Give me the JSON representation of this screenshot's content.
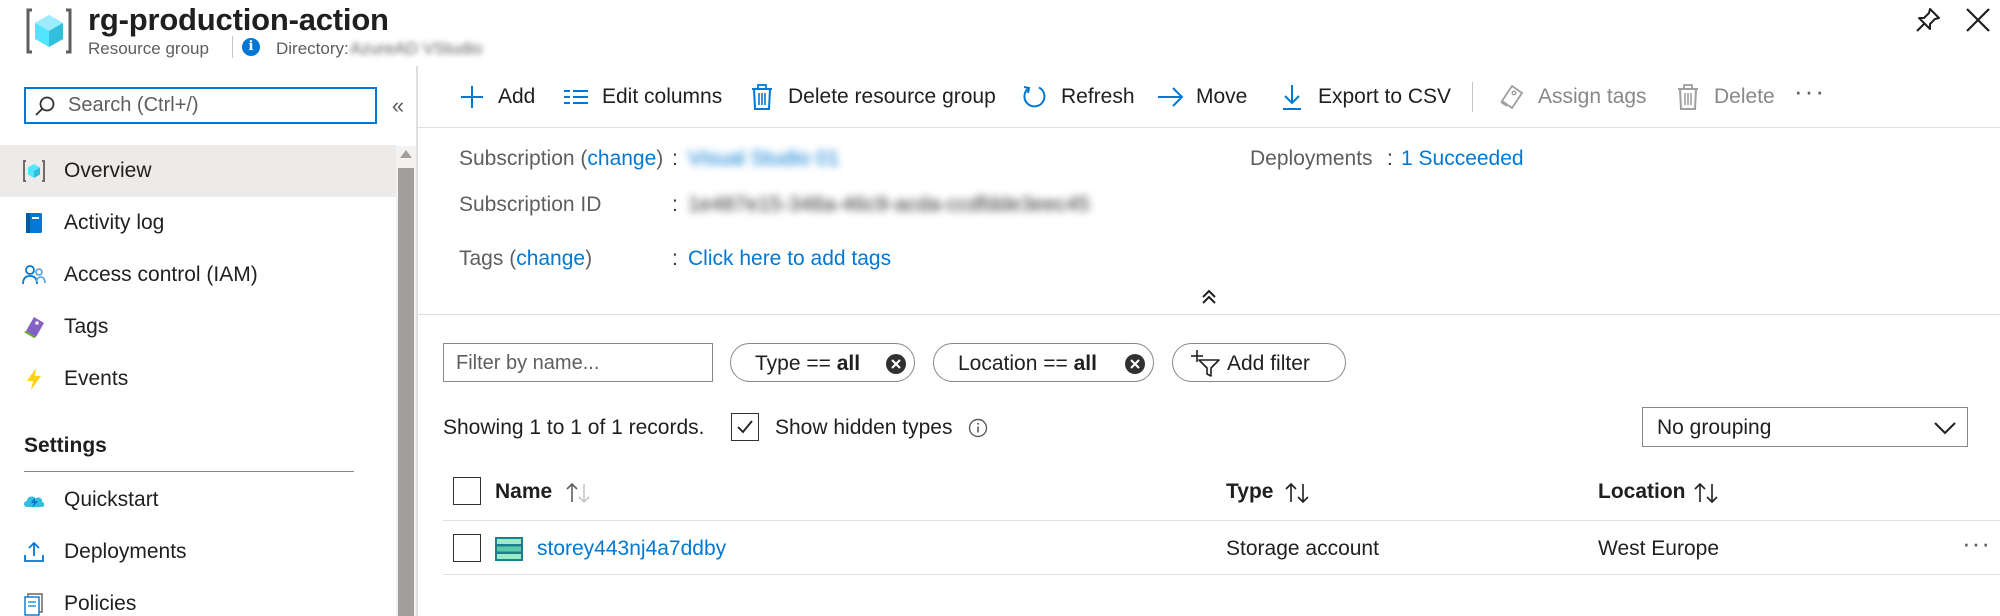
{
  "header": {
    "title": "rg-production-action",
    "subtitle": "Resource group",
    "directory_label": "Directory:",
    "directory_value": "AzureAD VStudio"
  },
  "sidebar": {
    "search_placeholder": "Search (Ctrl+/)",
    "collapse_glyph": "«",
    "items": [
      {
        "label": "Overview",
        "icon": "resource-group-icon",
        "selected": true
      },
      {
        "label": "Activity log",
        "icon": "activity-log-icon"
      },
      {
        "label": "Access control (IAM)",
        "icon": "people-icon"
      },
      {
        "label": "Tags",
        "icon": "tag-icon"
      },
      {
        "label": "Events",
        "icon": "lightning-icon"
      }
    ],
    "settings_title": "Settings",
    "settings_items": [
      {
        "label": "Quickstart",
        "icon": "cloud-icon"
      },
      {
        "label": "Deployments",
        "icon": "upload-icon"
      },
      {
        "label": "Policies",
        "icon": "policy-icon"
      }
    ]
  },
  "toolbar": {
    "add": "Add",
    "edit_columns": "Edit columns",
    "delete_rg": "Delete resource group",
    "refresh": "Refresh",
    "move": "Move",
    "export_csv": "Export to CSV",
    "assign_tags": "Assign tags",
    "delete": "Delete",
    "more": "···"
  },
  "essentials": {
    "subscription_label": "Subscription",
    "change": "change",
    "subscription_value": "Visual Studio 01",
    "subscription_id_label": "Subscription ID",
    "subscription_id_value": "1e487e15-348a-46c9-acda-ccdfdde3eec45",
    "tags_label": "Tags",
    "tags_value": "Click here to add tags",
    "deployments_label": "Deployments",
    "deployments_value": "1 Succeeded",
    "colon": ":"
  },
  "filters": {
    "name_placeholder": "Filter by name...",
    "type_prefix": "Type == ",
    "type_value": "all",
    "location_prefix": "Location == ",
    "location_value": "all",
    "add_filter": "Add filter"
  },
  "records": {
    "summary": "Showing 1 to 1 of 1 records.",
    "show_hidden": "Show hidden types",
    "show_hidden_checked": true,
    "grouping": "No grouping"
  },
  "table": {
    "columns": [
      "Name",
      "Type",
      "Location"
    ],
    "rows": [
      {
        "name": "storey443nj4a7ddby",
        "type": "Storage account",
        "location": "West Europe"
      }
    ],
    "row_more": "···"
  },
  "colors": {
    "accent": "#0078d4",
    "selected_bg": "#edebe9",
    "text": "#201f1e"
  }
}
